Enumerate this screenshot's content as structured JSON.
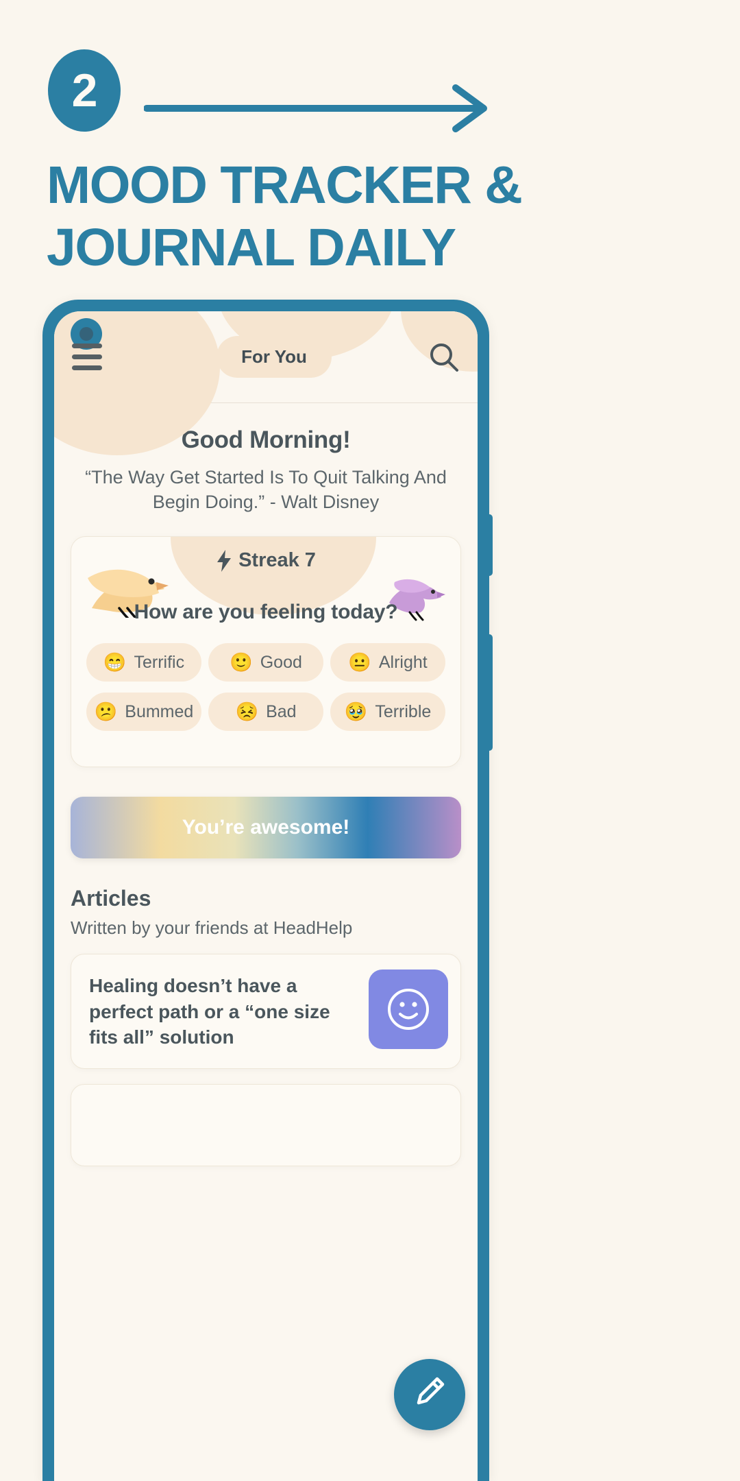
{
  "promo": {
    "step_number": "2",
    "arrow_icon": "arrow-right-icon",
    "title_line1": "MOOD TRACKER &",
    "title_line2": "JOURNAL DAILY",
    "accent_color": "#2b7fa3",
    "background_color": "#faf6ee"
  },
  "app": {
    "appbar": {
      "menu_icon": "hamburger-menu-icon",
      "tab_label": "For You",
      "search_icon": "search-icon"
    },
    "greeting": {
      "title": "Good Morning!",
      "quote": "“The Way Get Started Is To Quit Talking And Begin Doing.”  - Walt Disney"
    },
    "mood_card": {
      "streak_icon": "lightning-bolt-icon",
      "streak_label": "Streak 7",
      "bird_left_icon": "flying-bird-icon",
      "bird_right_icon": "flying-bird-icon",
      "question": "How are you feeling today?",
      "options": [
        {
          "emoji": "😁",
          "label": "Terrific"
        },
        {
          "emoji": "🙂",
          "label": "Good"
        },
        {
          "emoji": "😐",
          "label": "Alright"
        },
        {
          "emoji": "😕",
          "label": "Bummed"
        },
        {
          "emoji": "😣",
          "label": "Bad"
        },
        {
          "emoji": "🥹",
          "label": "Terrible"
        }
      ]
    },
    "banner": {
      "text": "You’re awesome!"
    },
    "articles": {
      "heading": "Articles",
      "subheading": "Written by your friends at HeadHelp",
      "items": [
        {
          "title": "Healing doesn’t have a perfect path or a “one size fits all” solution",
          "thumb_icon": "smiley-face-icon",
          "thumb_color": "#8189e3"
        }
      ]
    },
    "fab": {
      "icon": "pencil-edit-icon",
      "color": "#2b7fa3"
    }
  }
}
